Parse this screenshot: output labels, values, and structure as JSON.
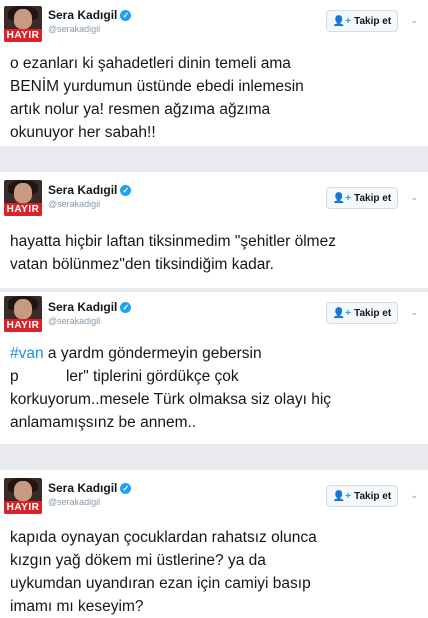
{
  "tweets": [
    {
      "name": "Sera Kadıgil",
      "handle": "@serakadigil",
      "follow_label": "Takip et",
      "avatar_banner": "HAYIR",
      "lines": [
        "o ezanları ki şahadetleri dinin temeli ama",
        "BENİM yurdumun üstünde ebedi inlemesin",
        "artık nolur ya! resmen ağzıma ağzıma",
        "okunuyor her sabah!!"
      ]
    },
    {
      "name": "Sera Kadıgil",
      "handle": "@serakadigil",
      "follow_label": "Takip et",
      "avatar_banner": "HAYIR",
      "lines": [
        "hayatta hiçbir laftan tiksinmedim \"şehitler ölmez",
        "vatan bölünmez\"den tiksindiğim kadar."
      ]
    },
    {
      "name": "Sera Kadıgil",
      "handle": "@serakadigil",
      "follow_label": "Takip et",
      "avatar_banner": "HAYIR",
      "hashtag": "#van",
      "lines": [
        " a yardm göndermeyin gebersin",
        "p           ler\" tiplerini gördükçe çok",
        "korkuyorum..mesele Türk olmaksa siz olayı hiç",
        "anlamamışsınz be annem.."
      ]
    },
    {
      "name": "Sera Kadıgil",
      "handle": "@serakadigil",
      "follow_label": "Takip et",
      "avatar_banner": "HAYIR",
      "lines": [
        "kapıda oynayan çocuklardan rahatsız olunca",
        "kızgın yağ dökem mi üstlerine? ya da",
        "uykumdan uyandıran ezan için camiyi basıp",
        "imamı mı keseyim?"
      ]
    }
  ],
  "icons": {
    "verified": "verified-badge-icon",
    "follow": "add-person-icon",
    "more": "chevron-down-icon"
  },
  "colors": {
    "link": "#1b95e0",
    "verified": "#1da1f2",
    "banner": "#d8232a"
  }
}
